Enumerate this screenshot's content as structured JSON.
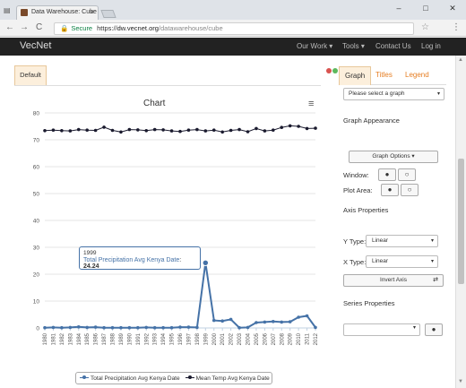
{
  "browser": {
    "tab_title": "Data Warehouse: Cube",
    "tab_close": "×",
    "win_min": "–",
    "win_max": "□",
    "win_close": "✕",
    "back": "←",
    "forward": "→",
    "reload": "C",
    "lock_glyph": "🔒",
    "secure_label": "Secure",
    "url_scheme": "https://",
    "url_host": "dw.vecnet.org",
    "url_path": "/datawarehouse/cube",
    "star": "☆",
    "menu": "⋮"
  },
  "navbar": {
    "brand": "VecNet",
    "links": [
      "Our Work ▾",
      "Tools ▾",
      "Contact Us",
      "Log in"
    ]
  },
  "left_tab": {
    "label": "Default"
  },
  "chart": {
    "menu_glyph": "≡"
  },
  "chart_data": {
    "type": "line",
    "title": "Chart",
    "x": [
      1980,
      1981,
      1982,
      1983,
      1984,
      1985,
      1986,
      1987,
      1988,
      1989,
      1990,
      1991,
      1992,
      1993,
      1994,
      1995,
      1996,
      1997,
      1998,
      1999,
      2000,
      2001,
      2002,
      2003,
      2004,
      2005,
      2006,
      2007,
      2008,
      2009,
      2010,
      2011,
      2012
    ],
    "ylim": [
      0,
      80
    ],
    "yticks": [
      0,
      10,
      20,
      30,
      40,
      50,
      60,
      70,
      80
    ],
    "grid": true,
    "legend_position": "bottom",
    "series": [
      {
        "name": "Total Precipitation Avg Kenya Date",
        "color": "#4572a7",
        "values": [
          0.1,
          0.2,
          0.1,
          0.2,
          0.4,
          0.2,
          0.3,
          0.1,
          0.1,
          0.1,
          0.1,
          0.1,
          0.2,
          0.1,
          0.1,
          0.1,
          0.3,
          0.3,
          0.2,
          24.24,
          2.8,
          2.6,
          3.2,
          0.1,
          0.2,
          2.0,
          2.2,
          2.4,
          2.2,
          2.3,
          4.0,
          4.5,
          0.2
        ]
      },
      {
        "name": "Mean Temp Avg Kenya Date",
        "color": "#1a1a2e",
        "values": [
          73.4,
          73.6,
          73.4,
          73.3,
          73.8,
          73.6,
          73.5,
          74.7,
          73.5,
          72.9,
          73.8,
          73.7,
          73.4,
          73.8,
          73.7,
          73.3,
          73.1,
          73.6,
          73.8,
          73.3,
          73.6,
          72.9,
          73.5,
          73.8,
          73.0,
          74.2,
          73.3,
          73.6,
          74.6,
          75.2,
          75.0,
          74.2,
          74.3
        ]
      }
    ],
    "tooltip": {
      "year": "1999",
      "series": "Total Precipitation Avg Kenya Date",
      "separator": ":",
      "value": "24.24"
    }
  },
  "panel": {
    "tabs": [
      "Graph",
      "Titles",
      "Legend"
    ],
    "graph_select_placeholder": "Please select a graph",
    "graph_appearance": "Graph Appearance",
    "graph_options_button": "Graph Options ▾",
    "window_label": "Window:",
    "plot_area_label": "Plot Area:",
    "filled_glyph": "●",
    "empty_glyph": "○",
    "axis_properties": "Axis Properties",
    "y_type_label": "Y Type:",
    "y_type_value": "Linear",
    "x_type_label": "X Type:",
    "x_type_value": "Linear",
    "invert_axis_button": "Invert Axis",
    "invert_icon": "⇄",
    "series_properties": "Series Properties",
    "caret": "▾"
  }
}
